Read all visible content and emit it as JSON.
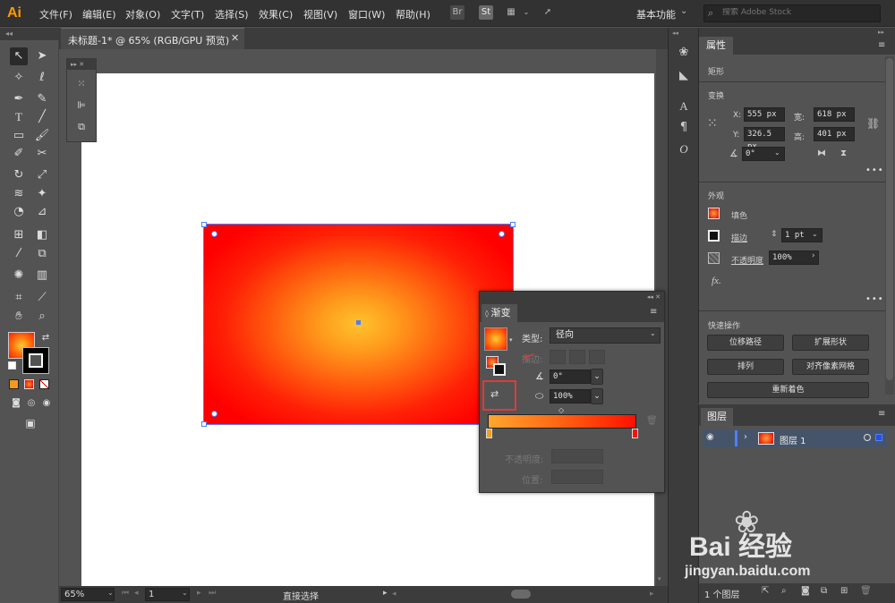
{
  "app": {
    "logo": "Ai"
  },
  "menubar": {
    "items": [
      "文件(F)",
      "编辑(E)",
      "对象(O)",
      "文字(T)",
      "选择(S)",
      "效果(C)",
      "视图(V)",
      "窗口(W)",
      "帮助(H)"
    ],
    "controls": {
      "bridge": "Br",
      "stock": "St"
    },
    "workspace": "基本功能",
    "search_placeholder": "搜索 Adobe Stock"
  },
  "document": {
    "tab_title": "未标题-1* @ 65% (RGB/GPU 预览)"
  },
  "statusbar": {
    "zoom": "65%",
    "artboard_number": "1",
    "status_text": "直接选择"
  },
  "properties": {
    "tab": "属性",
    "object_type": "矩形",
    "transform_title": "变换",
    "x_label": "X:",
    "x_value": "555 px",
    "y_label": "Y:",
    "y_value": "326.5 px",
    "w_label": "宽:",
    "w_value": "618 px",
    "h_label": "高:",
    "h_value": "401 px",
    "angle_value": "0°",
    "appearance_title": "外观",
    "fill_label": "填色",
    "stroke_label": "描边",
    "stroke_value": "1 pt",
    "opacity_label": "不透明度",
    "opacity_value": "100%",
    "fx_label": "fx.",
    "quick_actions_title": "快速操作",
    "buttons": {
      "offset_path": "位移路径",
      "expand_shape": "扩展形状",
      "arrange": "排列",
      "align_pixel_grid": "对齐像素网格",
      "recolor": "重新着色"
    }
  },
  "layers": {
    "tab": "图层",
    "layer_name": "图层 1",
    "count_text": "1 个图层"
  },
  "gradient_panel": {
    "tab": "渐变",
    "type_label": "类型:",
    "type_value": "径向",
    "stroke_label": "描边:",
    "angle_value": "0°",
    "aspect_value": "100%",
    "opacity_label": "不透明度:",
    "position_label": "位置:"
  },
  "colors": {
    "gradient_center": "#ffc22e",
    "gradient_edge": "#ff0000",
    "selection": "#4f7fff",
    "highlight_box": "#e03a3a"
  },
  "watermark": {
    "brand": "Bai 经验",
    "url": "jingyan.baidu.com"
  }
}
